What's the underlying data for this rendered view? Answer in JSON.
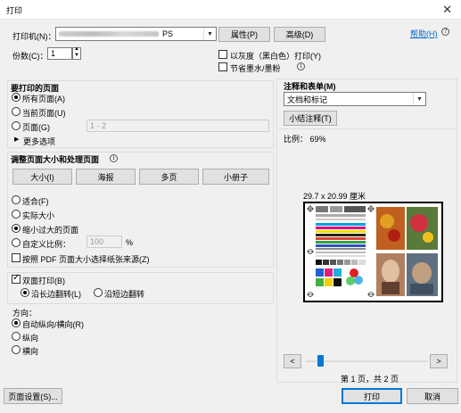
{
  "window": {
    "title": "打印",
    "close_glyph": "✕"
  },
  "printer": {
    "label": "打印机(N)：",
    "name_suffix": "PS",
    "properties_button": "属性(P)",
    "advanced_button": "高级(D)",
    "help_link": "帮助(H)",
    "copies_label": "份数(C)：",
    "copies_value": "1",
    "grayscale_label": "以灰度（黑白色）打印(Y)",
    "save_ink_label": "节省墨水/墨粉"
  },
  "pages_section": {
    "heading": "要打印的页面",
    "all_pages": "所有页面(A)",
    "current_page": "当前页面(U)",
    "pages": "页面(G)",
    "pages_range_placeholder": "1 - 2",
    "more_options": "更多选项"
  },
  "comments_section": {
    "heading": "注释和表单(M)",
    "selected": "文档和标记",
    "summarize_button": "小结注释(T)"
  },
  "sizing_section": {
    "heading": "调整页面大小和处理页面",
    "tabs": [
      "大小(I)",
      "海报",
      "多页",
      "小册子"
    ],
    "fit": "适合(F)",
    "actual_size": "实际大小",
    "shrink_oversized": "缩小过大的页面",
    "custom_scale": "自定义比例：",
    "custom_scale_value": "100",
    "percent": "%",
    "choose_paper_source": "按照 PDF 页面大小选择纸张来源(Z)"
  },
  "duplex_section": {
    "duplex_label": "双面打印(B)",
    "long_edge": "沿长边翻转(L)",
    "short_edge": "沿短边翻转"
  },
  "orientation_section": {
    "heading": "方向：",
    "auto": "自动纵向/横向(R)",
    "portrait": "纵向",
    "landscape": "横向"
  },
  "preview": {
    "scale": "比例： 69%",
    "paper_size": "29.7 x 20.99 厘米",
    "page_indicator": "第 1 页，共 2 页",
    "prev_glyph": "<",
    "next_glyph": ">"
  },
  "footer": {
    "page_setup_button": "页面设置(S)...",
    "print_button": "打印",
    "cancel_button": "取消"
  }
}
